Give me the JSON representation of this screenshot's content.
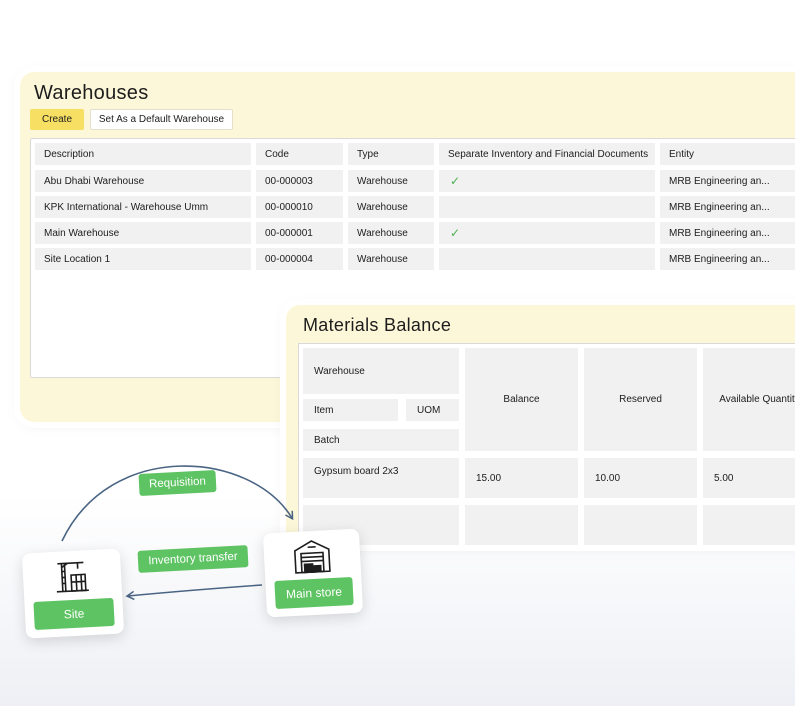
{
  "warehouses": {
    "title": "Warehouses",
    "create_label": "Create",
    "default_label": "Set As a Default Warehouse",
    "columns": [
      "Description",
      "Code",
      "Type",
      "Separate Inventory and Financial Documents",
      "Entity"
    ],
    "rows": [
      {
        "description": "Abu Dhabi Warehouse",
        "code": "00-000003",
        "type": "Warehouse",
        "separate": true,
        "entity": "MRB Engineering an..."
      },
      {
        "description": " KPK International - Warehouse Umm",
        "code": "00-000010",
        "type": "Warehouse",
        "separate": false,
        "entity": "MRB Engineering an..."
      },
      {
        "description": "Main Warehouse",
        "code": "00-000001",
        "type": "Warehouse",
        "separate": true,
        "entity": "MRB Engineering an..."
      },
      {
        "description": "Site Location 1",
        "code": "00-000004",
        "type": "Warehouse",
        "separate": false,
        "entity": "MRB Engineering an..."
      }
    ],
    "check_glyph": "✓",
    "check_color": "#4caf50"
  },
  "materials": {
    "title": "Materials Balance",
    "warehouse_label": "Warehouse",
    "item_label": "Item",
    "uom_label": "UOM",
    "batch_label": "Batch",
    "balance_label": "Balance",
    "reserved_label": "Reserved",
    "available_label": "Available Quantity",
    "row": {
      "item": "Gypsum board 2x3",
      "balance": "15.00",
      "reserved": "10.00",
      "available": "5.00"
    }
  },
  "flow": {
    "requisition_label": "Requisition",
    "transfer_label": "Inventory transfer",
    "site_label": "Site",
    "main_store_label": "Main store",
    "site_icon": "construction-crane-icon",
    "store_icon": "warehouse-icon",
    "accent": "#5ec363",
    "arrow_color": "#4a6484"
  }
}
